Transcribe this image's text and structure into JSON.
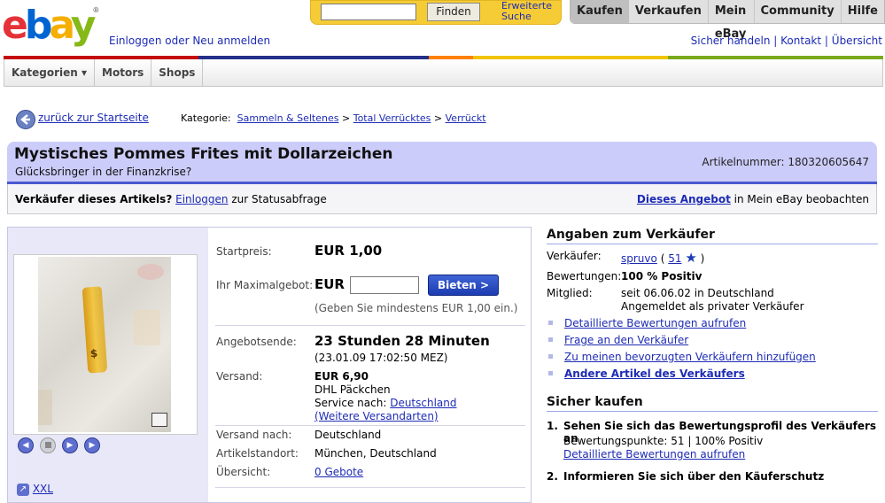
{
  "header": {
    "logo_letters": [
      "e",
      "b",
      "a",
      "y"
    ],
    "logo_reg": "®",
    "signin_prefix": "Einloggen",
    "signin_mid": " oder ",
    "signin_register": "Neu anmelden",
    "search_value": "",
    "find_label": "Finden",
    "advanced_search": "Erweiterte Suche",
    "tabs": [
      "Kaufen",
      "Verkaufen",
      "Mein eBay",
      "Community",
      "Hilfe"
    ],
    "links": [
      "Sicher handeln",
      "Kontakt",
      "Übersicht"
    ]
  },
  "catnav": [
    "Kategorien ▾",
    "Motors",
    "Shops"
  ],
  "breadcrumb": {
    "back": "zurück zur Startseite",
    "category_label": "Kategorie:",
    "items": [
      "Sammeln & Seltenes",
      "Total Verrücktes",
      "Verrückt"
    ],
    "separator": ">"
  },
  "item": {
    "title": "Mystisches Pommes Frites mit Dollarzeichen",
    "subtitle": "Glücksbringer in der Finanzkrise?",
    "number_label": "Artikelnummer:",
    "number": "180320605647"
  },
  "sellerbar": {
    "question": "Verkäufer dieses Artikels?",
    "login": "Einloggen",
    "status": "zur Statusabfrage",
    "watch_link": "Dieses Angebot",
    "watch_suffix": "in Mein eBay beobachten"
  },
  "photo": {
    "xxl": "XXL",
    "fry_mark": "$"
  },
  "details": {
    "start_label": "Startpreis:",
    "start_value": "EUR 1,00",
    "max_label": "Ihr Maximalgebot:",
    "currency": "EUR",
    "max_value": "",
    "bid_button": "Bieten >",
    "min_hint": "(Geben Sie mindestens EUR 1,00 ein.)",
    "end_label": "Angebotsende:",
    "end_value": "23 Stunden 28 Minuten",
    "end_date": "(23.01.09 17:02:50 MEZ)",
    "ship_label": "Versand:",
    "ship_price": "EUR 6,90",
    "ship_carrier": "DHL Päckchen",
    "ship_service_prefix": "Service nach:",
    "ship_service_link": "Deutschland",
    "ship_more": "(Weitere Versandarten)",
    "shipto_label": "Versand nach:",
    "shipto_value": "Deutschland",
    "loc_label": "Artikelstandort:",
    "loc_value": "München, Deutschland",
    "overview_label": "Übersicht:",
    "overview_value": "0 Gebote"
  },
  "seller": {
    "heading": "Angaben zum Verkäufer",
    "seller_label": "Verkäufer:",
    "seller_name": "spruvo",
    "rating_count": "51",
    "ratings_label": "Bewertungen:",
    "ratings_value": "100 % Positiv",
    "member_label": "Mitglied:",
    "member_since": "seit 06.06.02 in Deutschland",
    "member_type": "Angemeldet als privater Verkäufer",
    "links": [
      "Detaillierte Bewertungen aufrufen",
      "Frage an den Verkäufer",
      "Zu meinen bevorzugten Verkäufern hinzufügen",
      "Andere Artikel des Verkäufers"
    ]
  },
  "safe": {
    "heading": "Sicher kaufen",
    "step1": "Sehen Sie sich das Bewertungsprofil des Verkäufers an",
    "step1_detail": "Bewertungspunkte: 51 | 100% Positiv",
    "step1_link": "Detaillierte Bewertungen aufrufen",
    "step2": "Informieren Sie sich über den Käuferschutz"
  },
  "colors": {
    "accent_blue": "#4b59d0",
    "title_bg": "#ccccfa",
    "link": "#1d2bb4",
    "search_bg": "#f5cc35"
  }
}
